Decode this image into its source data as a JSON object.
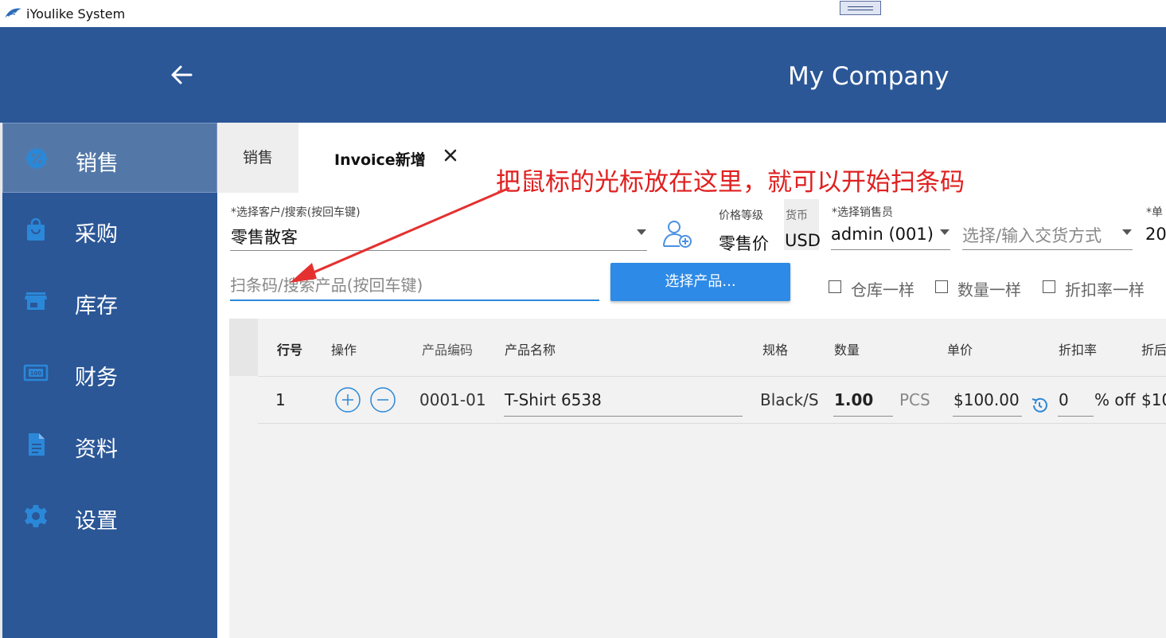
{
  "window": {
    "title": "iYoulike System"
  },
  "header": {
    "company": "My Company"
  },
  "sidebar": {
    "items": [
      {
        "label": "销售",
        "icon": "sales-icon",
        "active": true
      },
      {
        "label": "采购",
        "icon": "shopping-bag-icon"
      },
      {
        "label": "库存",
        "icon": "store-icon"
      },
      {
        "label": "财务",
        "icon": "money-icon"
      },
      {
        "label": "资料",
        "icon": "document-icon"
      },
      {
        "label": "设置",
        "icon": "gear-icon"
      }
    ]
  },
  "tabs": {
    "sales": "销售",
    "invoice": "Invoice新增"
  },
  "annotation": "把鼠标的光标放在这里，就可以开始扫条码",
  "form": {
    "customer_label": "*选择客户/搜索(按回车键)",
    "customer_value": "零售散客",
    "price_level_label": "价格等级",
    "price_level_value": "零售价",
    "currency_label": "货币",
    "currency_value": "USD",
    "salesperson_label": "*选择销售员",
    "salesperson_value": "admin (001)",
    "delivery_placeholder": "选择/输入交货方式",
    "date_label": "*单",
    "date_value": "20",
    "scan_placeholder": "扫条码/搜索产品(按回车键)",
    "select_product_button": "选择产品...",
    "checkboxes": [
      "仓库一样",
      "数量一样",
      "折扣率一样"
    ]
  },
  "table": {
    "headers": [
      "行号",
      "操作",
      "产品编码",
      "产品名称",
      "规格",
      "数量",
      "单价",
      "折扣率",
      "折后"
    ],
    "rows": [
      {
        "line": "1",
        "code": "0001-01",
        "name": "T-Shirt 6538",
        "spec": "Black/S",
        "qty": "1.00",
        "unit": "PCS",
        "price": "$100.00",
        "discount": "0",
        "discount_unit": "% off",
        "after": "$10"
      }
    ]
  },
  "colors": {
    "header": "#2b5797",
    "accent": "#2b88d8",
    "annotation": "#e02020"
  }
}
